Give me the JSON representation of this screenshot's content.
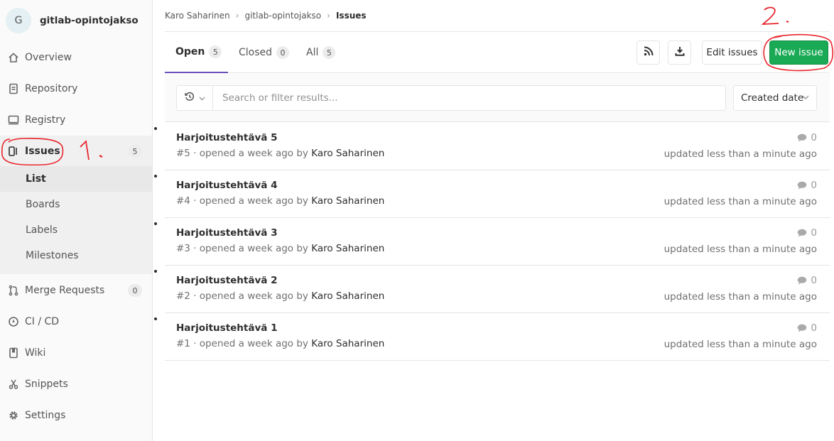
{
  "project": {
    "avatar_letter": "G",
    "name": "gitlab-opintojakso"
  },
  "sidebar": {
    "items": [
      {
        "label": "Overview",
        "icon": "home-icon"
      },
      {
        "label": "Repository",
        "icon": "doc-icon"
      },
      {
        "label": "Registry",
        "icon": "container-icon"
      },
      {
        "label": "Issues",
        "icon": "issues-icon",
        "count": "5"
      },
      {
        "label": "Merge Requests",
        "icon": "merge-request-icon",
        "count": "0"
      },
      {
        "label": "CI / CD",
        "icon": "rocket-icon"
      },
      {
        "label": "Wiki",
        "icon": "book-icon"
      },
      {
        "label": "Snippets",
        "icon": "scissors-icon"
      },
      {
        "label": "Settings",
        "icon": "gear-icon"
      }
    ],
    "issues_subnav": [
      "List",
      "Boards",
      "Labels",
      "Milestones"
    ]
  },
  "breadcrumb": [
    "Karo Saharinen",
    "gitlab-opintojakso",
    "Issues"
  ],
  "tabs": [
    {
      "label": "Open",
      "count": "5"
    },
    {
      "label": "Closed",
      "count": "0"
    },
    {
      "label": "All",
      "count": "5"
    }
  ],
  "toolbar": {
    "edit_label": "Edit issues",
    "new_label": "New issue"
  },
  "filter": {
    "placeholder": "Search or filter results...",
    "sort_label": "Created date"
  },
  "issues": [
    {
      "title": "Harjoitustehtävä 5",
      "ref": "#5",
      "opened": " · opened a week ago by ",
      "author": "Karo Saharinen",
      "comments": "0",
      "updated": "updated less than a minute ago"
    },
    {
      "title": "Harjoitustehtävä 4",
      "ref": "#4",
      "opened": " · opened a week ago by ",
      "author": "Karo Saharinen",
      "comments": "0",
      "updated": "updated less than a minute ago"
    },
    {
      "title": "Harjoitustehtävä 3",
      "ref": "#3",
      "opened": " · opened a week ago by ",
      "author": "Karo Saharinen",
      "comments": "0",
      "updated": "updated less than a minute ago"
    },
    {
      "title": "Harjoitustehtävä 2",
      "ref": "#2",
      "opened": " · opened a week ago by ",
      "author": "Karo Saharinen",
      "comments": "0",
      "updated": "updated less than a minute ago"
    },
    {
      "title": "Harjoitustehtävä 1",
      "ref": "#1",
      "opened": " · opened a week ago by ",
      "author": "Karo Saharinen",
      "comments": "0",
      "updated": "updated less than a minute ago"
    }
  ],
  "colors": {
    "accent": "#6b4fbb",
    "success": "#1aaa55",
    "annotation": "#e8262d"
  }
}
